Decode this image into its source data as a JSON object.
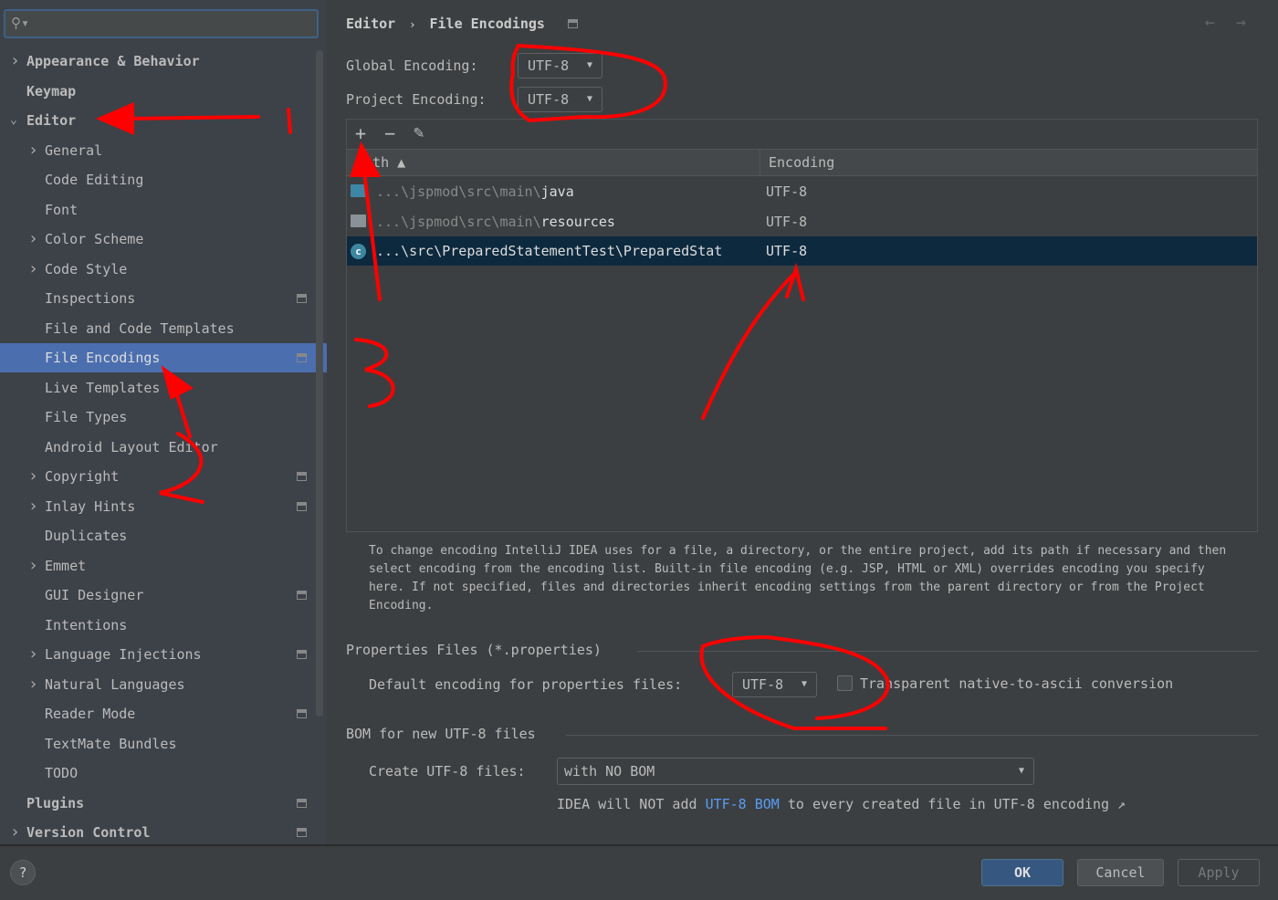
{
  "search": {
    "placeholder": ""
  },
  "sidebar": {
    "items": [
      {
        "label": "Appearance & Behavior",
        "level": 0,
        "arrow": "right",
        "bold": true
      },
      {
        "label": "Keymap",
        "level": 0,
        "bold": true
      },
      {
        "label": "Editor",
        "level": 0,
        "arrow": "down",
        "bold": true
      },
      {
        "label": "General",
        "level": 1,
        "arrow": "right"
      },
      {
        "label": "Code Editing",
        "level": 1
      },
      {
        "label": "Font",
        "level": 1
      },
      {
        "label": "Color Scheme",
        "level": 1,
        "arrow": "right"
      },
      {
        "label": "Code Style",
        "level": 1,
        "arrow": "right"
      },
      {
        "label": "Inspections",
        "level": 1,
        "badge": true
      },
      {
        "label": "File and Code Templates",
        "level": 1
      },
      {
        "label": "File Encodings",
        "level": 1,
        "badge": true,
        "selected": true
      },
      {
        "label": "Live Templates",
        "level": 1
      },
      {
        "label": "File Types",
        "level": 1
      },
      {
        "label": "Android Layout Editor",
        "level": 1
      },
      {
        "label": "Copyright",
        "level": 1,
        "arrow": "right",
        "badge": true
      },
      {
        "label": "Inlay Hints",
        "level": 1,
        "arrow": "right",
        "badge": true
      },
      {
        "label": "Duplicates",
        "level": 1
      },
      {
        "label": "Emmet",
        "level": 1,
        "arrow": "right"
      },
      {
        "label": "GUI Designer",
        "level": 1,
        "badge": true
      },
      {
        "label": "Intentions",
        "level": 1
      },
      {
        "label": "Language Injections",
        "level": 1,
        "arrow": "right",
        "badge": true
      },
      {
        "label": "Natural Languages",
        "level": 1,
        "arrow": "right"
      },
      {
        "label": "Reader Mode",
        "level": 1,
        "badge": true
      },
      {
        "label": "TextMate Bundles",
        "level": 1
      },
      {
        "label": "TODO",
        "level": 1
      },
      {
        "label": "Plugins",
        "level": 0,
        "bold": true,
        "badge": true
      },
      {
        "label": "Version Control",
        "level": 0,
        "arrow": "right",
        "bold": true,
        "badge": true
      }
    ]
  },
  "header": {
    "breadcrumb_parent": "Editor",
    "separator": "›",
    "breadcrumb_current": "File Encodings",
    "back": "←",
    "forward": "→"
  },
  "global_encoding": {
    "label": "Global Encoding:",
    "value": "UTF-8"
  },
  "project_encoding": {
    "label": "Project Encoding:",
    "value": "UTF-8"
  },
  "toolbar": {
    "add": "+",
    "remove": "−",
    "edit": "✎"
  },
  "table": {
    "columns": [
      "Path ▲",
      "Encoding"
    ],
    "rows": [
      {
        "icon": "folder-icon",
        "prefix": "...\\jspmod\\src\\main\\",
        "name": "java",
        "encoding": "UTF-8"
      },
      {
        "icon": "resources-folder-icon",
        "prefix": "...\\jspmod\\src\\main\\",
        "name": "resources",
        "encoding": "UTF-8"
      },
      {
        "icon": "java-class-icon",
        "prefix": "",
        "name": "...\\src\\PreparedStatementTest\\PreparedStat",
        "encoding": "UTF-8",
        "selected": true
      }
    ]
  },
  "help_text": [
    "To change encoding IntelliJ IDEA uses for a file, a directory, or the entire project, add its path if necessary and then",
    "select encoding from the encoding list. Built-in file encoding (e.g. JSP, HTML or XML) overrides encoding you specify",
    "here. If not specified, files and directories inherit encoding settings from the parent directory or from the Project",
    "Encoding."
  ],
  "properties": {
    "section": "Properties Files (*.properties)",
    "label": "Default encoding for properties files:",
    "value": "UTF-8",
    "checkbox_label": "Transparent native-to-ascii conversion",
    "checked": false
  },
  "bom": {
    "section": "BOM for new UTF-8 files",
    "label": "Create UTF-8 files:",
    "value": "with NO BOM",
    "note_pre": "IDEA will NOT add ",
    "note_link": "UTF-8 BOM",
    "note_post": " to every created file in UTF-8 encoding ↗"
  },
  "footer": {
    "help": "?",
    "ok": "OK",
    "cancel": "Cancel",
    "apply": "Apply"
  },
  "colors": {
    "accent": "#4b6eaf",
    "ok_button": "#365880",
    "selected_row": "#0d293e",
    "annotation": "#ff0000"
  }
}
